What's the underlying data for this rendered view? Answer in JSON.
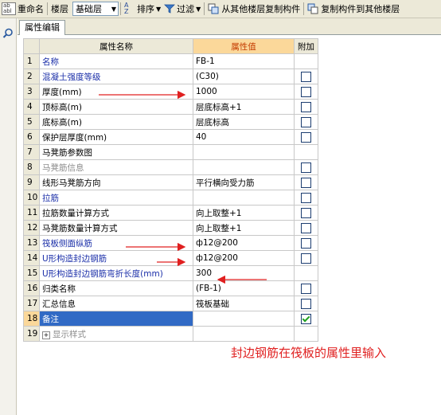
{
  "toolbar": {
    "rename_label": "重命名",
    "floor_label": "楼层",
    "floor_value": "基础层",
    "sort_label": "排序",
    "filter_label": "过滤",
    "copy_from_label": "从其他楼层复制构件",
    "copy_to_label": "复制构件到其他楼层"
  },
  "tab": {
    "label": "属性编辑"
  },
  "grid": {
    "header": {
      "name": "属性名称",
      "value": "属性值",
      "attach": "附加"
    },
    "rows": [
      {
        "no": "1",
        "name": "名称",
        "value": "FB-1"
      },
      {
        "no": "2",
        "name": "混凝土强度等级",
        "value": "(C30)"
      },
      {
        "no": "3",
        "name": "厚度(mm)",
        "value": "1000"
      },
      {
        "no": "4",
        "name": "顶标高(m)",
        "value": "层底标高+1"
      },
      {
        "no": "5",
        "name": "底标高(m)",
        "value": "层底标高"
      },
      {
        "no": "6",
        "name": "保护层厚度(mm)",
        "value": "40"
      },
      {
        "no": "7",
        "name": "马凳筋参数图",
        "value": ""
      },
      {
        "no": "8",
        "name": "马凳筋信息",
        "value": ""
      },
      {
        "no": "9",
        "name": "线形马凳筋方向",
        "value": "平行横向受力筋"
      },
      {
        "no": "10",
        "name": "拉筋",
        "value": ""
      },
      {
        "no": "11",
        "name": "拉筋数量计算方式",
        "value": "向上取整+1"
      },
      {
        "no": "12",
        "name": "马凳筋数量计算方式",
        "value": "向上取整+1"
      },
      {
        "no": "13",
        "name": "筏板侧面纵筋",
        "value": "ф12@200"
      },
      {
        "no": "14",
        "name": "U形构造封边钢筋",
        "value": "ф12@200"
      },
      {
        "no": "15",
        "name": "U形构造封边钢筋弯折长度(mm)",
        "value": "300"
      },
      {
        "no": "16",
        "name": "归类名称",
        "value": "(FB-1)"
      },
      {
        "no": "17",
        "name": "汇总信息",
        "value": "筏板基础"
      },
      {
        "no": "18",
        "name": "备注",
        "value": ""
      },
      {
        "no": "19",
        "name": "显示样式",
        "value": ""
      }
    ]
  },
  "annotation": {
    "text": "封边钢筋在筏板的属性里输入"
  },
  "colors": {
    "annotation_red": "#e02020",
    "selection_blue": "#316ac5",
    "header_highlight": "#fbd89a"
  }
}
